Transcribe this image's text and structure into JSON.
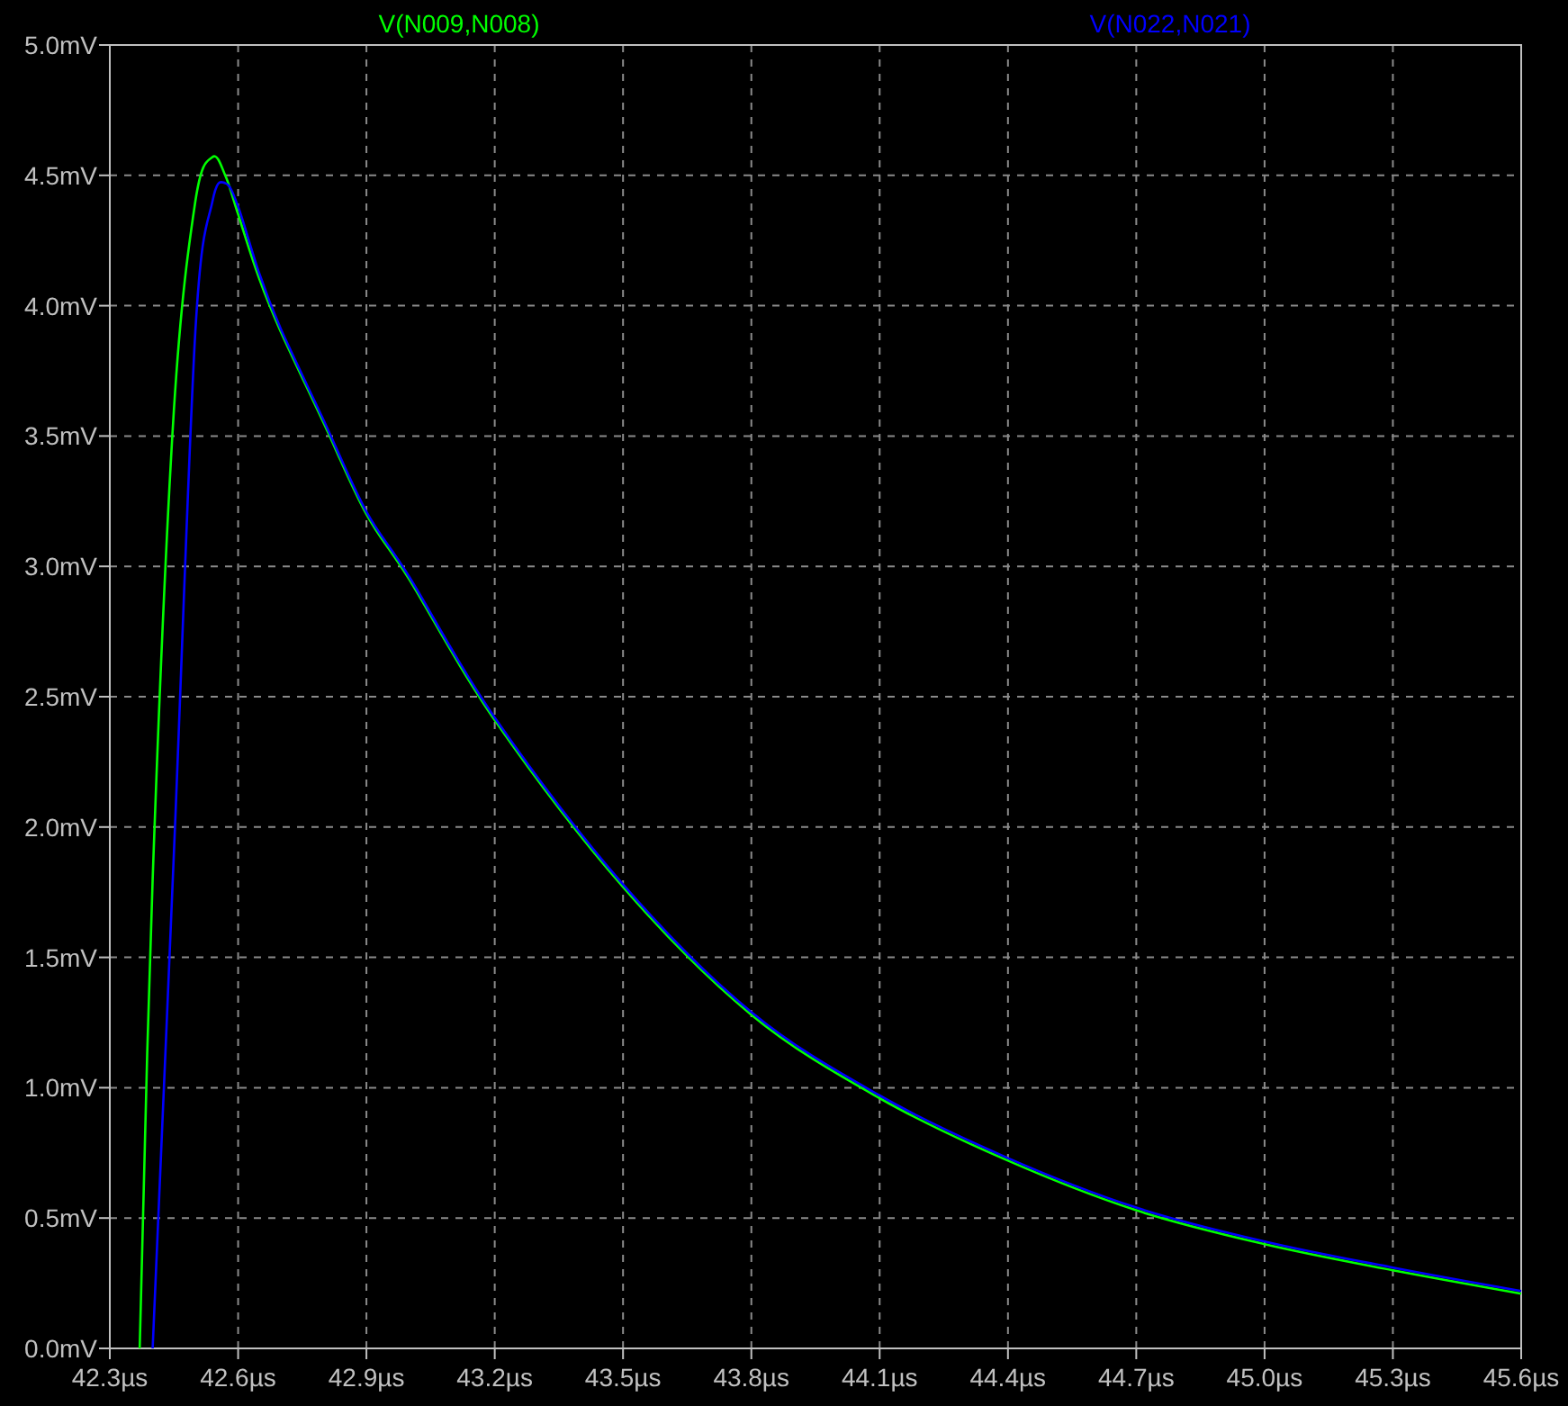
{
  "plot": {
    "chart_data": {
      "type": "line",
      "grid": true,
      "x": [
        42.37,
        42.4,
        42.45,
        42.5,
        42.54,
        42.57,
        42.6,
        42.65,
        42.7,
        42.8,
        42.9,
        43.0,
        43.2,
        43.5,
        43.8,
        44.1,
        44.4,
        44.7,
        45.0,
        45.3,
        45.6
      ],
      "series": [
        {
          "name": "V(N009,N008)",
          "color": "#00ff00",
          "values": [
            0,
            1.8,
            3.6,
            4.4,
            4.57,
            4.5,
            4.35,
            4.1,
            3.9,
            3.55,
            3.2,
            2.95,
            2.41,
            1.77,
            1.28,
            0.96,
            0.72,
            0.53,
            0.4,
            0.3,
            0.21
          ]
        },
        {
          "name": "V(N022,N021)",
          "color": "#0000ff",
          "values": [
            null,
            0,
            1.9,
            3.9,
            4.4,
            4.47,
            4.38,
            4.12,
            3.91,
            3.56,
            3.21,
            2.96,
            2.42,
            1.78,
            1.29,
            0.97,
            0.73,
            0.54,
            0.41,
            0.31,
            0.22
          ]
        }
      ],
      "xlim": [
        42.3,
        45.6
      ],
      "ylim": [
        0,
        5
      ],
      "xticks": [
        {
          "value": 42.3,
          "label": "42.3µs"
        },
        {
          "value": 42.6,
          "label": "42.6µs"
        },
        {
          "value": 42.9,
          "label": "42.9µs"
        },
        {
          "value": 43.2,
          "label": "43.2µs"
        },
        {
          "value": 43.5,
          "label": "43.5µs"
        },
        {
          "value": 43.8,
          "label": "43.8µs"
        },
        {
          "value": 44.1,
          "label": "44.1µs"
        },
        {
          "value": 44.4,
          "label": "44.4µs"
        },
        {
          "value": 44.7,
          "label": "44.7µs"
        },
        {
          "value": 45.0,
          "label": "45.0µs"
        },
        {
          "value": 45.3,
          "label": "45.3µs"
        },
        {
          "value": 45.6,
          "label": "45.6µs"
        }
      ],
      "yticks": [
        {
          "value": 0,
          "label": "0.0mV"
        },
        {
          "value": 0.5,
          "label": "0.5mV"
        },
        {
          "value": 1,
          "label": "1.0mV"
        },
        {
          "value": 1.5,
          "label": "1.5mV"
        },
        {
          "value": 2,
          "label": "2.0mV"
        },
        {
          "value": 2.5,
          "label": "2.5mV"
        },
        {
          "value": 3,
          "label": "3.0mV"
        },
        {
          "value": 3.5,
          "label": "3.5mV"
        },
        {
          "value": 4,
          "label": "4.0mV"
        },
        {
          "value": 4.5,
          "label": "4.5mV"
        },
        {
          "value": 5,
          "label": "5.0mV"
        }
      ]
    }
  }
}
